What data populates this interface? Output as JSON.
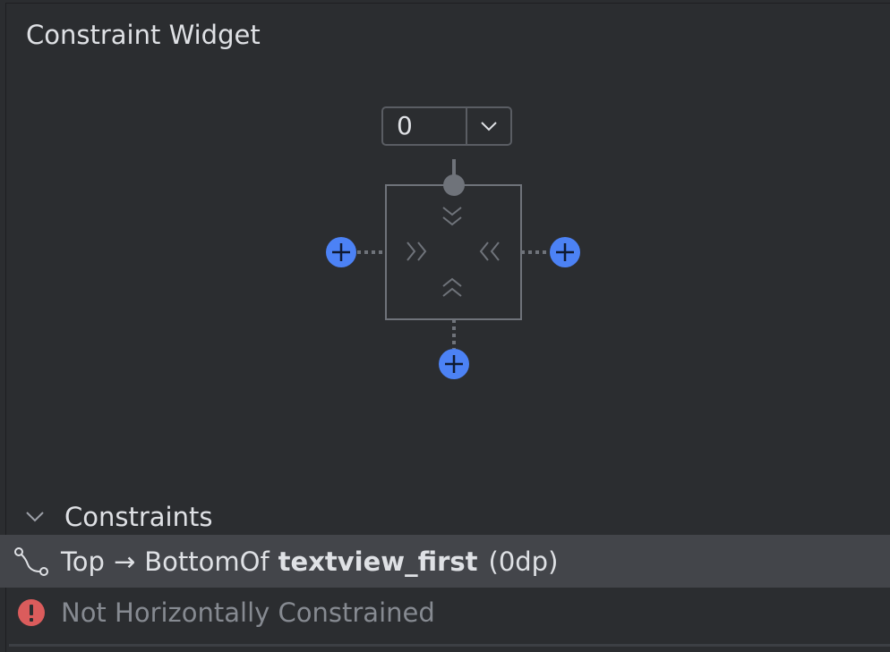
{
  "panel": {
    "title": "Constraint Widget"
  },
  "widget": {
    "top_margin_value": "0",
    "icons": {
      "dropdown": "chevron-down-icon",
      "add_left": "add-constraint-icon",
      "add_right": "add-constraint-icon",
      "add_bottom": "add-constraint-icon",
      "top_anchor": "constraint-anchor-icon"
    },
    "colors": {
      "add_button": "#4c82f5",
      "outline": "#6f737a",
      "anchor": "#6f737a"
    }
  },
  "constraints": {
    "header": "Constraints",
    "expanded": true,
    "items": [
      {
        "icon": "constraint-link-icon",
        "side": "Top",
        "arrow": "→",
        "relation": "BottomOf",
        "target": "textview_first",
        "margin": "(0dp)"
      }
    ],
    "warning": {
      "icon": "error-icon",
      "text": "Not Horizontally Constrained",
      "color": "#db5c5c"
    }
  }
}
